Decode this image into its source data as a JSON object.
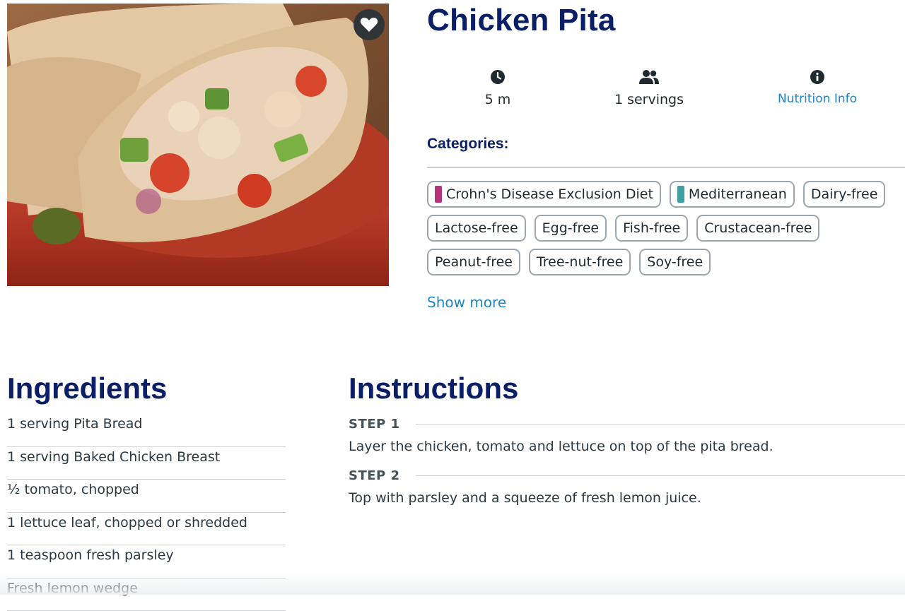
{
  "recipe": {
    "title": "Chicken Pita",
    "image_alt": "Chicken pita sandwich in a red bowl",
    "favorite_icon": "heart-icon"
  },
  "meta": {
    "time": {
      "icon": "clock-icon",
      "value": "5 m"
    },
    "servings": {
      "icon": "users-icon",
      "value": "1 servings"
    },
    "nutrition": {
      "icon": "info-icon",
      "label": "Nutrition Info"
    }
  },
  "categories": {
    "label": "Categories:",
    "tags": [
      {
        "label": "Crohn's Disease Exclusion Diet",
        "color": "#b5337a"
      },
      {
        "label": "Mediterranean",
        "color": "#3f9fa3"
      },
      {
        "label": "Dairy-free"
      },
      {
        "label": "Lactose-free"
      },
      {
        "label": "Egg-free"
      },
      {
        "label": "Fish-free"
      },
      {
        "label": "Crustacean-free"
      },
      {
        "label": "Peanut-free"
      },
      {
        "label": "Tree-nut-free"
      },
      {
        "label": "Soy-free"
      }
    ],
    "show_more": "Show more"
  },
  "ingredients": {
    "title": "Ingredients",
    "items": [
      "1 serving Pita Bread",
      "1 serving Baked Chicken Breast",
      "½ tomato, chopped",
      "1 lettuce leaf, chopped or shredded",
      "1 teaspoon fresh parsley",
      "Fresh lemon wedge"
    ]
  },
  "instructions": {
    "title": "Instructions",
    "steps": [
      {
        "label": "STEP 1",
        "text": "Layer the chicken, tomato and lettuce on top of the pita bread."
      },
      {
        "label": "STEP 2",
        "text": "Top with parsley and a squeeze of fresh lemon juice."
      }
    ]
  },
  "colors": {
    "heading": "#0b1f66",
    "link": "#1f86c4",
    "body_text": "#2b3a42",
    "tag_border": "#9aa7b2"
  }
}
